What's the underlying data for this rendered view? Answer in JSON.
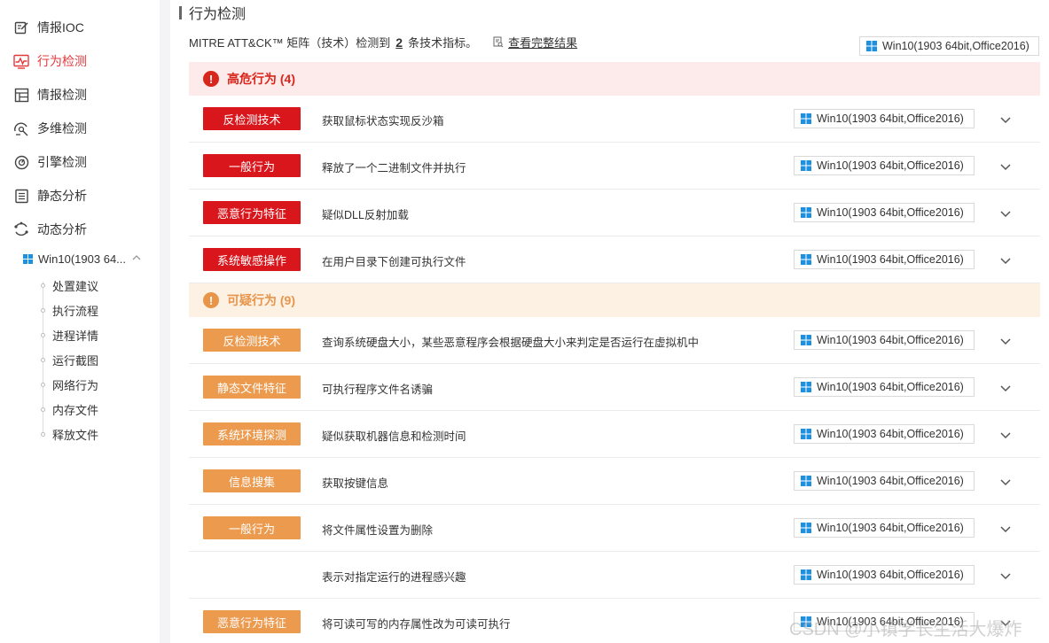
{
  "sidebar": {
    "items": [
      {
        "label": "情报IOC",
        "icon": "edit-note-icon"
      },
      {
        "label": "行为检测",
        "icon": "pulse-chart-icon",
        "active": true
      },
      {
        "label": "情报检测",
        "icon": "layout-grid-icon"
      },
      {
        "label": "多维检测",
        "icon": "radar-icon"
      },
      {
        "label": "引擎检测",
        "icon": "engine-gauge-icon"
      },
      {
        "label": "静态分析",
        "icon": "list-doc-icon"
      },
      {
        "label": "动态分析",
        "icon": "refresh-cycle-icon"
      }
    ],
    "env": {
      "label": "Win10(1903 64...",
      "icon": "windows-icon"
    },
    "sub_items": [
      "处置建议",
      "执行流程",
      "进程详情",
      "运行截图",
      "网络行为",
      "内存文件",
      "释放文件"
    ]
  },
  "main": {
    "title": "行为检测",
    "summary_prefix": "MITRE ATT&CK™ 矩阵（技术）检测到",
    "summary_count": "2",
    "summary_suffix": "条技术指标。",
    "view_link": "查看完整结果",
    "env_selector": "Win10(1903 64bit,Office2016)",
    "high_group": {
      "label": "高危行为 (4)",
      "rows": [
        {
          "tag": "反检测技术",
          "desc": "获取鼠标状态实现反沙箱",
          "env": "Win10(1903 64bit,Office2016)"
        },
        {
          "tag": "一般行为",
          "desc": "释放了一个二进制文件并执行",
          "env": "Win10(1903 64bit,Office2016)"
        },
        {
          "tag": "恶意行为特征",
          "desc": "疑似DLL反射加载",
          "env": "Win10(1903 64bit,Office2016)"
        },
        {
          "tag": "系统敏感操作",
          "desc": "在用户目录下创建可执行文件",
          "env": "Win10(1903 64bit,Office2016)"
        }
      ]
    },
    "suspicious_group": {
      "label": "可疑行为 (9)",
      "rows": [
        {
          "tag": "反检测技术",
          "desc": "查询系统硬盘大小，某些恶意程序会根据硬盘大小来判定是否运行在虚拟机中",
          "env": "Win10(1903 64bit,Office2016)"
        },
        {
          "tag": "静态文件特征",
          "desc": "可执行程序文件名诱骗",
          "env": "Win10(1903 64bit,Office2016)"
        },
        {
          "tag": "系统环境探测",
          "desc": "疑似获取机器信息和检测时间",
          "env": "Win10(1903 64bit,Office2016)"
        },
        {
          "tag": "信息搜集",
          "desc": "获取按键信息",
          "env": "Win10(1903 64bit,Office2016)"
        },
        {
          "tag": "一般行为",
          "desc": "将文件属性设置为删除",
          "env": "Win10(1903 64bit,Office2016)"
        },
        {
          "tag": "",
          "desc": "表示对指定运行的进程感兴趣",
          "env": "Win10(1903 64bit,Office2016)"
        },
        {
          "tag": "恶意行为特征",
          "desc": "将可读可写的内存属性改为可读可执行",
          "env": "Win10(1903 64bit,Office2016)"
        }
      ]
    }
  },
  "watermark": "CSDN @小镇学长生活大爆炸",
  "colors": {
    "accent": "#e4393c",
    "high_tag": "#d9161c",
    "suspicious_tag": "#eb9a4e",
    "windows_blue": "#1e90e0"
  }
}
